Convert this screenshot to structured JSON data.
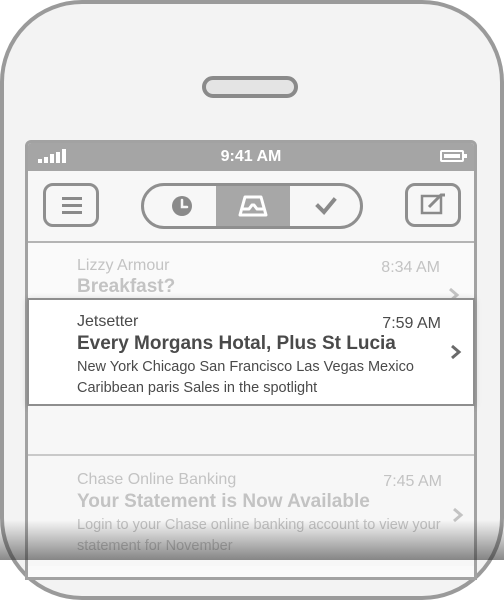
{
  "status_bar": {
    "time": "9:41 AM",
    "signal_icon": "signal-bars-icon",
    "battery_icon": "battery-icon"
  },
  "toolbar": {
    "menu_icon": "hamburger-menu-icon",
    "segments": [
      {
        "icon": "clock-icon",
        "selected": false
      },
      {
        "icon": "inbox-tray-icon",
        "selected": true
      },
      {
        "icon": "checkmark-icon",
        "selected": false
      }
    ],
    "compose_icon": "compose-icon"
  },
  "mails": [
    {
      "sender": "Lizzy Armour",
      "time": "8:34 AM",
      "subject": "Breakfast?",
      "preview": ""
    },
    {
      "sender": "Jetsetter",
      "time": "7:59 AM",
      "subject": "Every Morgans Hotal, Plus St Lucia",
      "preview": "New York Chicago San Francisco Las Vegas Mexico Caribbean paris Sales in the spotlight"
    },
    {
      "sender": "Chase Online Banking",
      "time": "7:45 AM",
      "subject": "Your Statement is Now Available",
      "preview": "Login to your Chase online banking account to view your statement for November"
    }
  ],
  "colors": {
    "accent_gray": "#a7a7a7",
    "frame": "#9a9a9a",
    "text_dark": "#4a4a4a",
    "text_faded": "#c3c3c3"
  }
}
